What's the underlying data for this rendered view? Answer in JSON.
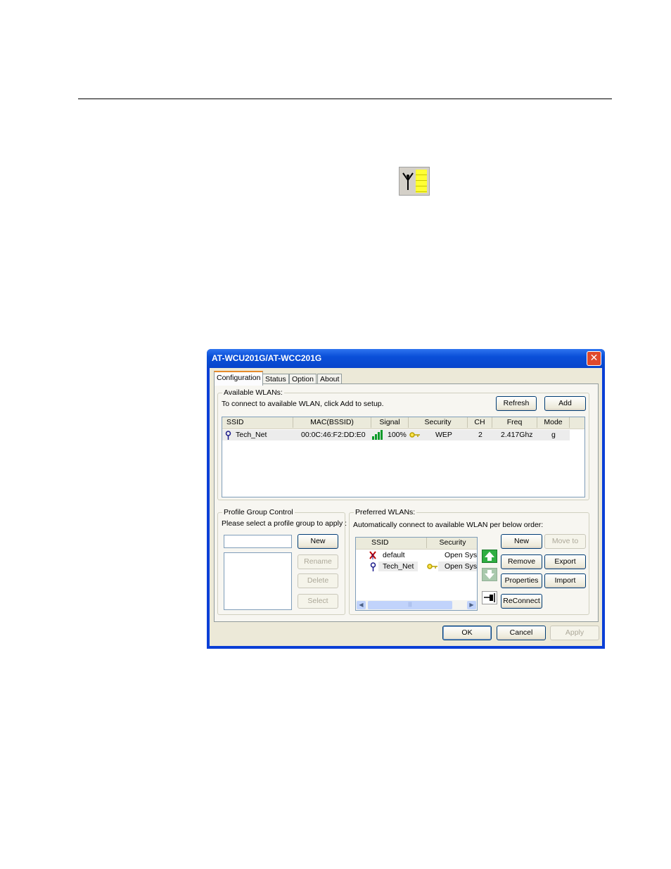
{
  "dialog": {
    "title": "AT-WCU201G/AT-WCC201G",
    "close_glyph": "✕",
    "tabs": [
      {
        "label": "Configuration"
      },
      {
        "label": "Status"
      },
      {
        "label": "Option"
      },
      {
        "label": "About"
      }
    ],
    "available": {
      "group_label": "Available WLANs:",
      "hint": "To connect to available WLAN, click Add to setup.",
      "refresh_label": "Refresh",
      "add_label": "Add",
      "columns": [
        "SSID",
        "MAC(BSSID)",
        "Signal",
        "Security",
        "CH",
        "Freq",
        "Mode"
      ],
      "rows": [
        {
          "ssid": "Tech_Net",
          "mac": "00:0C:46:F2:DD:E0",
          "signal": "100%",
          "security": "WEP",
          "ch": "2",
          "freq": "2.417Ghz",
          "mode": "g"
        }
      ]
    },
    "profile_group": {
      "group_label": "Profile Group Control",
      "hint": "Please select a profile group to apply :",
      "input_value": "",
      "new_label": "New",
      "rename_label": "Rename",
      "delete_label": "Delete",
      "select_label": "Select"
    },
    "preferred": {
      "group_label": "Preferred WLANs:",
      "hint": "Automatically connect to available WLAN per below order:",
      "columns": [
        "SSID",
        "Security"
      ],
      "rows": [
        {
          "ssid": "default",
          "security": "Open Syst"
        },
        {
          "ssid": "Tech_Net",
          "security": "Open Syst"
        }
      ],
      "scroll_grip": "|||",
      "new_label": "New",
      "move_to_label": "Move to",
      "remove_label": "Remove",
      "export_label": "Export",
      "properties_label": "Properties",
      "import_label": "Import",
      "reconnect_label": "ReConnect"
    },
    "footer": {
      "ok_label": "OK",
      "cancel_label": "Cancel",
      "apply_label": "Apply"
    }
  }
}
